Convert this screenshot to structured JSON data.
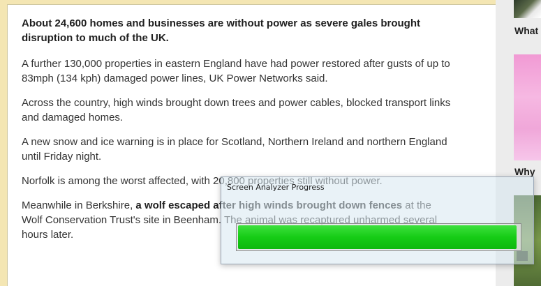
{
  "article": {
    "lead": "About 24,600 homes and businesses are without power as severe gales brought disruption to much of the UK.",
    "p1": "A further 130,000 properties in eastern England have had power restored after gusts of up to 83mph (134 kph) damaged power lines, UK Power Networks said.",
    "p2": "Across the country, high winds brought down trees and power cables, blocked transport links and damaged homes.",
    "p3": "A new snow and ice warning is in place for Scotland, Northern Ireland and northern England until Friday night.",
    "p4": "Norfolk is among the worst affected, with 20,800 properties still without power.",
    "p5_before": "Meanwhile in Berkshire, ",
    "p5_link": "a wolf escaped after high winds brought down fences",
    "p5_after": " at the Wolf Conservation Trust's site in Beenham. The animal was recaptured unharmed several hours later."
  },
  "sidebar": {
    "headline_1": "What",
    "headline_2": "Why"
  },
  "progress_dialog": {
    "title": "Screen Analyzer Progress",
    "progress_fraction": 0.99,
    "fill_color": "#16cc16"
  }
}
